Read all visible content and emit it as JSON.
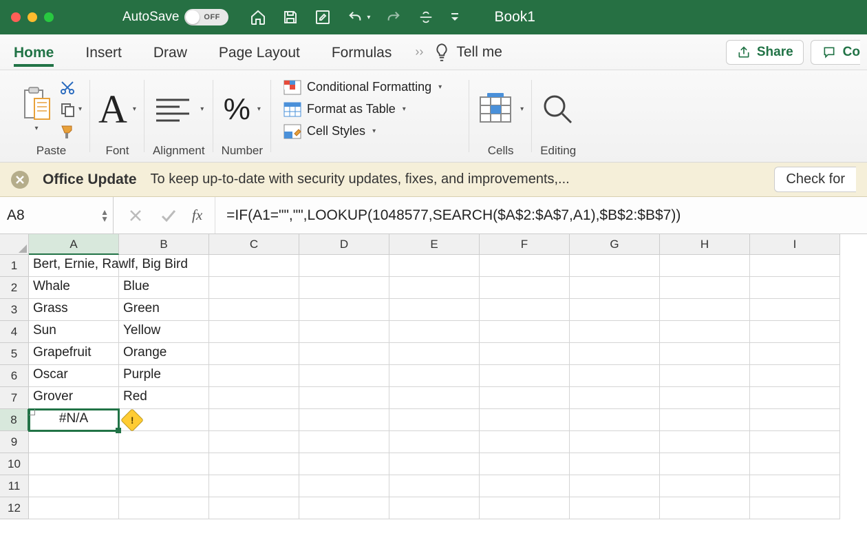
{
  "titlebar": {
    "autosave_label": "AutoSave",
    "autosave_state": "OFF",
    "doc_title": "Book1"
  },
  "tabs": {
    "home": "Home",
    "insert": "Insert",
    "draw": "Draw",
    "page_layout": "Page Layout",
    "formulas": "Formulas",
    "tell_me": "Tell me",
    "share": "Share",
    "comments": "Co"
  },
  "ribbon": {
    "paste_group": "Paste",
    "font_group": "Font",
    "alignment_group": "Alignment",
    "number_group": "Number",
    "cond_fmt": "Conditional Formatting",
    "fmt_table": "Format as Table",
    "cell_styles": "Cell Styles",
    "cells_group": "Cells",
    "editing_group": "Editing"
  },
  "updatebar": {
    "title": "Office Update",
    "msg": "To keep up-to-date with security updates, fixes, and improvements,...",
    "button": "Check for"
  },
  "fxbar": {
    "cell_ref": "A8",
    "fx_label": "fx",
    "formula": "=IF(A1=\"\",\"\",LOOKUP(1048577,SEARCH($A$2:$A$7,A1),$B$2:$B$7))"
  },
  "columns": [
    "A",
    "B",
    "C",
    "D",
    "E",
    "F",
    "G",
    "H",
    "I"
  ],
  "rows_visible": 12,
  "selected_cell": {
    "row": 8,
    "col": "A"
  },
  "cells": {
    "A1": "Bert, Ernie, Rawlf, Big Bird",
    "A2": "Whale",
    "B2": "Blue",
    "A3": "Grass",
    "B3": "Green",
    "A4": "Sun",
    "B4": "Yellow",
    "A5": "Grapefruit",
    "B5": "Orange",
    "A6": "Oscar",
    "B6": "Purple",
    "A7": "Grover",
    "B7": "Red",
    "A8": "#N/A"
  },
  "error_indicator_cell": "A8"
}
